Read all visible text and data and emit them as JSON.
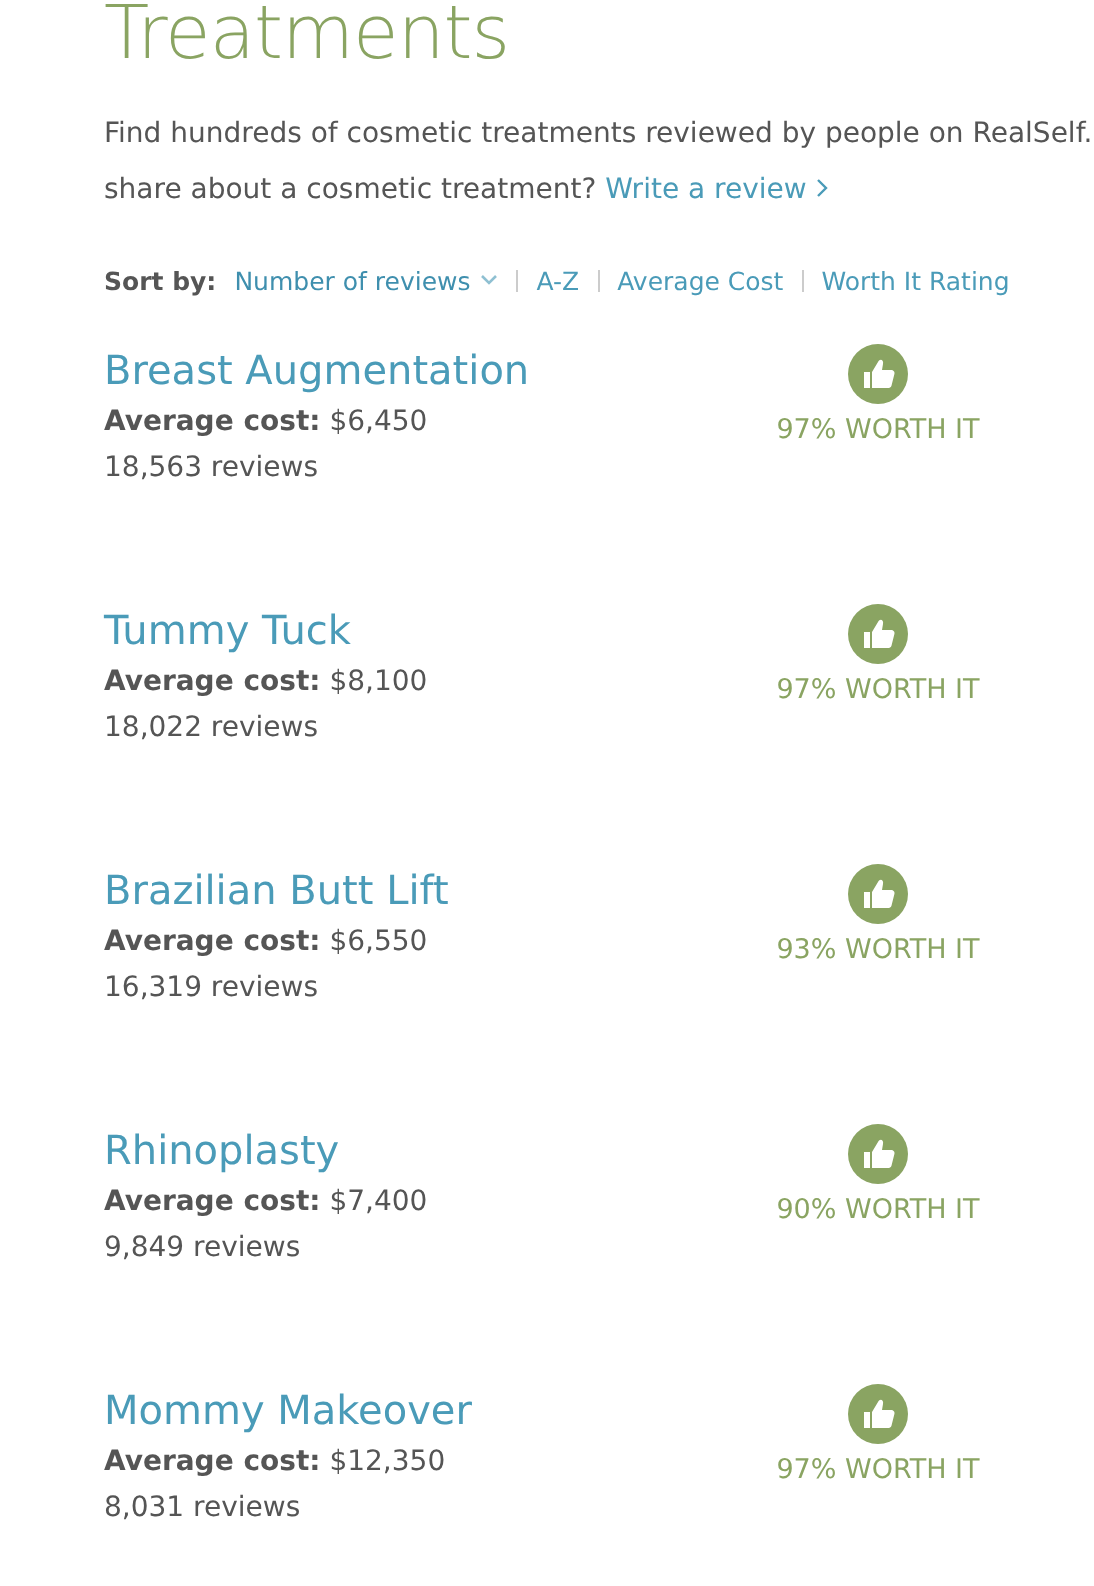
{
  "title": "Treatments",
  "intro": {
    "line_1": "Find hundreds of cosmetic treatments reviewed by people on RealSelf.",
    "line_2": "share about a cosmetic treatment?",
    "link": "Write a review"
  },
  "sort": {
    "label": "Sort by:",
    "options": [
      {
        "label": "Number of reviews",
        "selected": true
      },
      {
        "label": "A-Z",
        "selected": false
      },
      {
        "label": "Average Cost",
        "selected": false
      },
      {
        "label": "Worth It Rating",
        "selected": false
      }
    ]
  },
  "treatments": [
    {
      "name": "Breast Augmentation",
      "cost_label": "Average cost:",
      "cost": "$6,450",
      "reviews": "18,563 reviews",
      "rating": "97% WORTH IT"
    },
    {
      "name": "Tummy Tuck",
      "cost_label": "Average cost:",
      "cost": "$8,100",
      "reviews": "18,022 reviews",
      "rating": "97% WORTH IT"
    },
    {
      "name": "Brazilian Butt Lift",
      "cost_label": "Average cost:",
      "cost": "$6,550",
      "reviews": "16,319 reviews",
      "rating": "93% WORTH IT"
    },
    {
      "name": "Rhinoplasty",
      "cost_label": "Average cost:",
      "cost": "$7,400",
      "reviews": "9,849 reviews",
      "rating": "90% WORTH IT"
    },
    {
      "name": "Mommy Makeover",
      "cost_label": "Average cost:",
      "cost": "$12,350",
      "reviews": "8,031 reviews",
      "rating": "97% WORTH IT"
    }
  ]
}
